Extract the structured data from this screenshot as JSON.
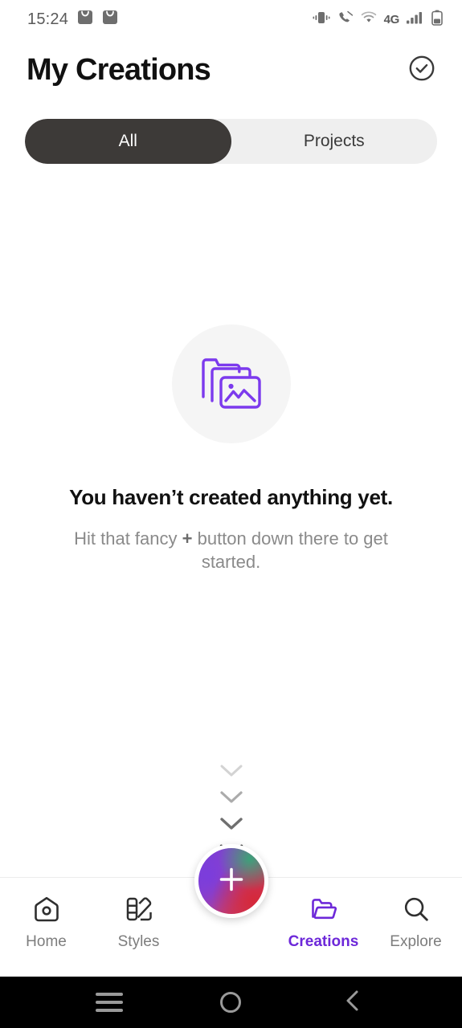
{
  "statusbar": {
    "time": "15:24",
    "left_icons": [
      "notification-badge-icon",
      "notification-badge-icon"
    ],
    "network_label": "4G",
    "right_icons": [
      "vibrate-icon",
      "call-mute-icon",
      "wifi-icon",
      "signal-bars-icon",
      "battery-icon"
    ]
  },
  "header": {
    "title": "My Creations",
    "action_icon": "check-circle-icon"
  },
  "segmented": {
    "options": [
      {
        "label": "All",
        "active": true
      },
      {
        "label": "Projects",
        "active": false
      }
    ],
    "active_bg": "#3d3a38",
    "track_bg": "#efefef"
  },
  "empty_state": {
    "illustration": "stacked-folders-image-icon",
    "illustration_color": "#7c3aed",
    "title": "You haven’t created anything yet.",
    "subtitle_before": "Hit that fancy ",
    "subtitle_plus": "+",
    "subtitle_after": " button down there to get started."
  },
  "hint_arrows": {
    "icon": "chevron-down-icon",
    "count": 4,
    "opacities": [
      0.18,
      0.35,
      0.6,
      0.95
    ]
  },
  "bottom_nav": {
    "items": [
      {
        "label": "Home",
        "icon": "home-icon",
        "active": false
      },
      {
        "label": "Styles",
        "icon": "palette-icon",
        "active": false
      },
      {
        "label": "Creations",
        "icon": "folder-open-icon",
        "active": true
      },
      {
        "label": "Explore",
        "icon": "search-icon",
        "active": false
      }
    ],
    "active_color": "#6d28d9",
    "inactive_color": "#7d7d7d",
    "fab": {
      "icon": "plus-icon",
      "label": "+"
    }
  },
  "android_nav": {
    "buttons": [
      "recents-icon",
      "home-circle-icon",
      "back-icon"
    ]
  }
}
